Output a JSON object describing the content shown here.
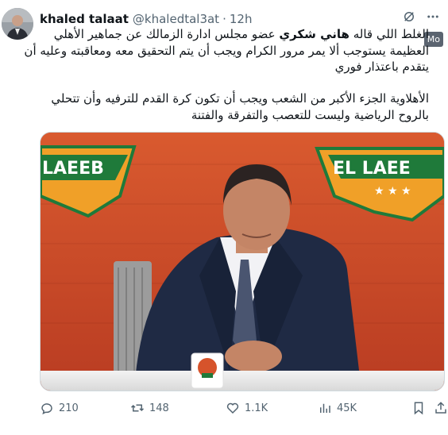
{
  "author": {
    "name": "khaled talaat",
    "handle": "@khaledtal3at",
    "separator": "·",
    "time": "12h"
  },
  "tooltip": "Mo",
  "tweet_text": {
    "p1_pre": "الغلط اللي قاله ",
    "p1_bold": "هاني شكري",
    "p1_post": " عضو مجلس ادارة الزمالك عن جماهير الأهلي العظيمة يستوجب ألا يمر مرور الكرام ويجب أن يتم التحقيق معه ومعاقبته وعليه أن يتقدم باعتذار فوري",
    "p2": "الأهلاوية الجزء الأكبر من الشعب ويجب أن تكون كرة القدم للترفيه وأن تتحلي بالروح الرياضية وليست للتعصب والتفرقة والفتنة"
  },
  "media": {
    "backdrop_text_left": "LAEEB",
    "backdrop_text_right": "EL LAEE",
    "brand_orange": "#d6532b",
    "brand_green": "#1f7a3a"
  },
  "actions": {
    "replies": "210",
    "reposts": "148",
    "likes": "1.1K",
    "views": "45K"
  },
  "icons": [
    "grok-icon",
    "reply-icon",
    "repost-icon",
    "like-icon",
    "views-icon",
    "bookmark-icon",
    "share-icon"
  ]
}
